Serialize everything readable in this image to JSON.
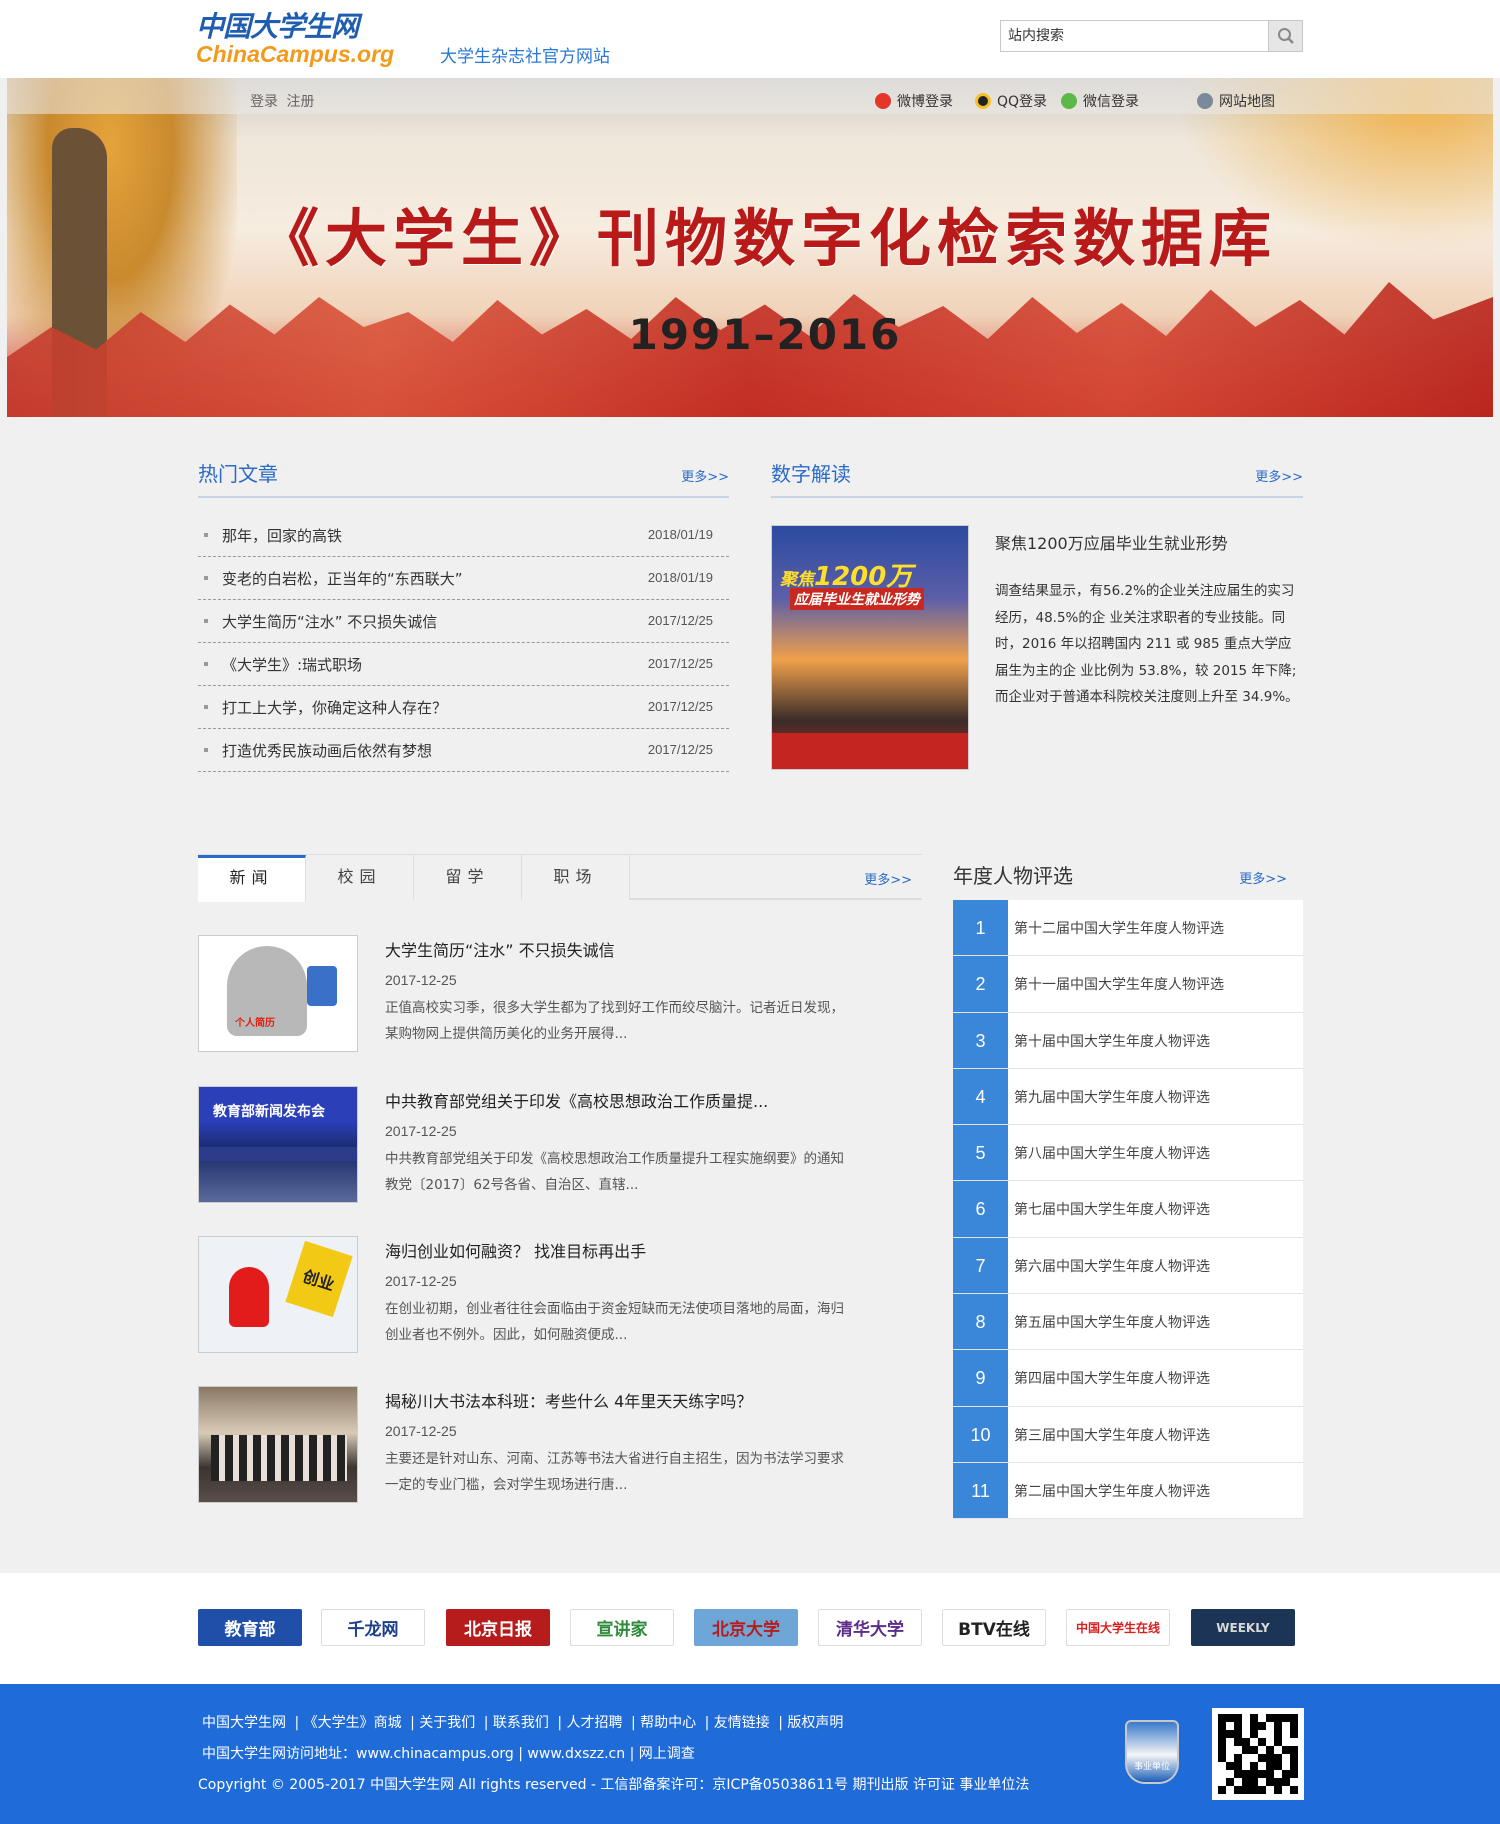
{
  "header": {
    "logo_cn": "中国大学生网",
    "logo_en": "ChinaCampus.org",
    "subtitle": "大学生杂志社官方网站",
    "search_placeholder": "站内搜索"
  },
  "banner": {
    "login": "登录",
    "register": "注册",
    "weibo_login": "微博登录",
    "qq_login": "QQ登录",
    "wechat_login": "微信登录",
    "sitemap": "网站地图",
    "title": "《大学生》刊物数字化检索数据库",
    "years": "1991–2016"
  },
  "hot": {
    "title": "热门文章",
    "more": "更多>>",
    "items": [
      {
        "title": "那年，回家的高铁",
        "date": "2018/01/19"
      },
      {
        "title": "变老的白岩松，正当年的“东西联大”",
        "date": "2018/01/19"
      },
      {
        "title": "大学生简历“注水” 不只损失诚信",
        "date": "2017/12/25"
      },
      {
        "title": "《大学生》:瑞式职场",
        "date": "2017/12/25"
      },
      {
        "title": "打工上大学，你确定这种人存在？",
        "date": "2017/12/25"
      },
      {
        "title": "打造优秀民族动画后依然有梦想",
        "date": "2017/12/25"
      }
    ]
  },
  "digits": {
    "title": "数字解读",
    "more": "更多>>",
    "img_line1_a": "聚焦",
    "img_line1_b": "1200万",
    "img_line2": "应届毕业生就业形势",
    "article_title": "聚焦1200万应届毕业生就业形势",
    "article_body": "调查结果显示，有56.2%的企业关注应届生的实习经历，48.5%的企 业关注求职者的专业技能。同时，2016 年以招聘国内 211 或 985 重点大学应届生为主的企 业比例为 53.8%，较 2015 年下降;而企业对于普通本科院校关注度则上升至 34.9%。"
  },
  "tabs": {
    "items": [
      "新闻",
      "校园",
      "留学",
      "职场"
    ],
    "more": "更多>>"
  },
  "news": [
    {
      "title": "大学生简历“注水” 不只损失诚信",
      "date": "2017-12-25",
      "desc": "正值高校实习季，很多大学生都为了找到好工作而绞尽脑汁。记者近日发现，某购物网上提供简历美化的业务开展得...",
      "thumb_text": "个人简历"
    },
    {
      "title": "中共教育部党组关于印发《高校思想政治工作质量提...",
      "date": "2017-12-25",
      "desc": "中共教育部党组关于印发《高校思想政治工作质量提升工程实施纲要》的通知教党〔2017〕62号各省、自治区、直辖...",
      "thumb_text": "教育部新闻发布会"
    },
    {
      "title": "海归创业如何融资？ 找准目标再出手",
      "date": "2017-12-25",
      "desc": "在创业初期，创业者往往会面临由于资金短缺而无法使项目落地的局面，海归创业者也不例外。因此，如何融资便成...",
      "thumb_text": "创业"
    },
    {
      "title": "揭秘川大书法本科班：考些什么 4年里天天练字吗？",
      "date": "2017-12-25",
      "desc": "主要还是针对山东、河南、江苏等书法大省进行自主招生，因为书法学习要求一定的专业门槛，会对学生现场进行唐...",
      "thumb_text": ""
    }
  ],
  "ranking": {
    "title": "年度人物评选",
    "more": "更多>>",
    "items": [
      {
        "num": "1",
        "label": "第十二届中国大学生年度人物评选"
      },
      {
        "num": "2",
        "label": "第十一届中国大学生年度人物评选"
      },
      {
        "num": "3",
        "label": "第十届中国大学生年度人物评选"
      },
      {
        "num": "4",
        "label": "第九届中国大学生年度人物评选"
      },
      {
        "num": "5",
        "label": "第八届中国大学生年度人物评选"
      },
      {
        "num": "6",
        "label": "第七届中国大学生年度人物评选"
      },
      {
        "num": "7",
        "label": "第六届中国大学生年度人物评选"
      },
      {
        "num": "8",
        "label": "第五届中国大学生年度人物评选"
      },
      {
        "num": "9",
        "label": "第四届中国大学生年度人物评选"
      },
      {
        "num": "10",
        "label": "第三届中国大学生年度人物评选"
      },
      {
        "num": "11",
        "label": "第二届中国大学生年度人物评选"
      }
    ]
  },
  "partners": [
    {
      "label": "教育部",
      "color": "#1f4fa8",
      "text": "#ffffff"
    },
    {
      "label": "千龙网",
      "color": "#ffffff",
      "text": "#1c3f8c"
    },
    {
      "label": "北京日报",
      "color": "#b71c1c",
      "text": "#ffffff"
    },
    {
      "label": "宣讲家",
      "color": "#ffffff",
      "text": "#2e8b3a"
    },
    {
      "label": "北京大学",
      "color": "#6fa6d8",
      "text": "#b71c1c"
    },
    {
      "label": "清华大学",
      "color": "#ffffff",
      "text": "#5b2d8a"
    },
    {
      "label": "BTV在线",
      "color": "#ffffff",
      "text": "#222222"
    },
    {
      "label": "中国大学生在线",
      "color": "#ffffff",
      "text": "#d81e1e"
    },
    {
      "label": "WEEKLY",
      "color": "#1c3556",
      "text": "#d8d8d8"
    }
  ],
  "footer": {
    "links": [
      "中国大学生网",
      "《大学生》商城",
      "关于我们",
      "联系我们",
      "人才招聘",
      "帮助中心",
      "友情链接",
      "版权声明"
    ],
    "addr": "中国大学生网访问地址：www.chinacampus.org | www.dxszz.cn | 网上调查",
    "copy": "Copyright © 2005-2017   中国大学生网 All rights reserved - 工信部备案许可：京ICP备05038611号 期刊出版 许可证 事业单位法",
    "badge": "事业单位"
  }
}
